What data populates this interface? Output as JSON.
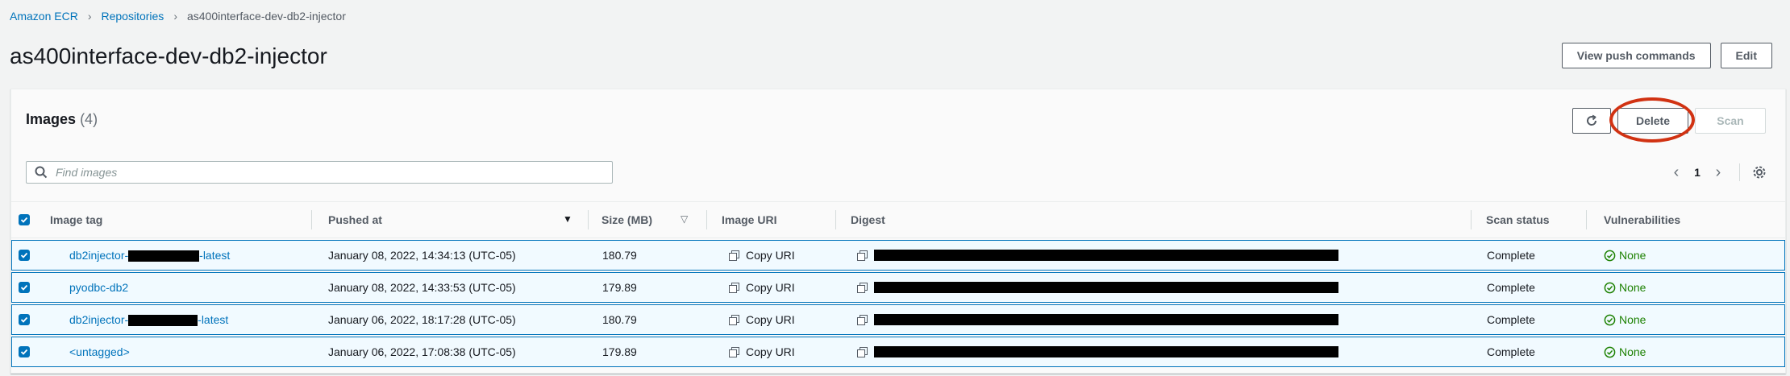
{
  "breadcrumb": {
    "items": [
      "Amazon ECR",
      "Repositories",
      "as400interface-dev-db2-injector"
    ]
  },
  "page": {
    "title": "as400interface-dev-db2-injector",
    "view_push_label": "View push commands",
    "edit_label": "Edit"
  },
  "images": {
    "title": "Images",
    "count": "(4)",
    "delete_label": "Delete",
    "scan_label": "Scan",
    "search_placeholder": "Find images",
    "page_number": "1",
    "columns": [
      "Image tag",
      "Pushed at",
      "Size (MB)",
      "Image URI",
      "Digest",
      "Scan status",
      "Vulnerabilities"
    ],
    "rows": [
      {
        "tag_prefix": "db2injector-",
        "tag_suffix": "-latest",
        "pushed": "January 08, 2022, 14:34:13 (UTC-05)",
        "size": "180.79",
        "uri": "Copy URI",
        "status": "Complete",
        "vuln": "None"
      },
      {
        "tag_prefix": "pyodbc-db2",
        "tag_suffix": "",
        "pushed": "January 08, 2022, 14:33:53 (UTC-05)",
        "size": "179.89",
        "uri": "Copy URI",
        "status": "Complete",
        "vuln": "None"
      },
      {
        "tag_prefix": "db2injector-",
        "tag_suffix": "-latest",
        "pushed": "January 06, 2022, 18:17:28 (UTC-05)",
        "size": "180.79",
        "uri": "Copy URI",
        "status": "Complete",
        "vuln": "None"
      },
      {
        "tag_prefix": "<untagged>",
        "tag_suffix": "",
        "pushed": "January 06, 2022, 17:08:38 (UTC-05)",
        "size": "179.89",
        "uri": "Copy URI",
        "status": "Complete",
        "vuln": "None"
      }
    ]
  },
  "colors": {
    "link": "#0073bb",
    "success": "#1d8102",
    "annotation": "#d13212"
  }
}
